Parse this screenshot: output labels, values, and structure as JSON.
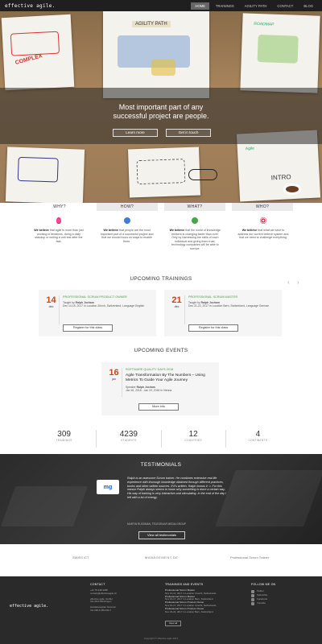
{
  "header": {
    "logo": "effective agile.",
    "nav": [
      "HOME",
      "TRAININGS",
      "AGILITY PATH",
      "CONTACT",
      "BLOG"
    ],
    "active_index": 0
  },
  "hero": {
    "title_line1": "Most important part of any",
    "title_line2": "successful project are people.",
    "btn_learn": "Learn more",
    "btn_touch": "Get in touch",
    "sketch_texts": [
      "AGILITY PATH",
      "COMPLEX",
      "INTRO",
      "ROADMAP",
      "Agile"
    ]
  },
  "tabs": [
    "WHY?",
    "HOW?",
    "WHAT?",
    "WHO?"
  ],
  "why": [
    {
      "bold": "We believe",
      "text": "that agile is more than just working in iterations, doing a daily standup or writing a unit test after the fact."
    },
    {
      "bold": "We believe",
      "text": "that people are the most important part of a successful project and that we should focus on ways to enable them."
    },
    {
      "bold": "We believe",
      "text": "that the world of knowledge workers is changing faster than ever. Only by harnessing the skills of each individual and giving them trust, technology companies will be able to survive."
    },
    {
      "bold": "We believe",
      "text": "that what we have to address our current believe system and that we need to challenge everything."
    }
  ],
  "trainings": {
    "title": "UPCOMING TRAININGS",
    "items": [
      {
        "day": "14",
        "month": "dec",
        "category": "PROFESSIONAL SCRUM PRODUCT OWNER",
        "taught_label": "Taught by",
        "trainer": "Ralph Jocham",
        "meta": "Dec 14-15, 2017 in Location Zürich, Switzerland, Language English",
        "button": "Register for this class"
      },
      {
        "day": "21",
        "month": "dec",
        "category": "PROFESSIONAL SCRUM MASTER",
        "taught_label": "Taught by",
        "trainer": "Ralph Jocham",
        "meta": "Dec 21-22, 2017 in Location Bern, Switzerland, Language German",
        "button": "Register for this class"
      }
    ]
  },
  "events": {
    "title": "UPCOMING EVENTS",
    "item": {
      "day": "16",
      "month": "jan",
      "category": "SOFTWARE QUALITY DAYS 2018",
      "title": "Agile Transformation By The Numbers – Using Metrics To Guide Your Agile Journey",
      "speaker_label": "Speaker",
      "speaker": "Ralph Jocham",
      "meta": "Jan 16, 2018 - Jan 19, 2018 in Vienna",
      "button": "More info"
    }
  },
  "stats": [
    {
      "num": "309",
      "label": "TRAININGS"
    },
    {
      "num": "4239",
      "label": "STUDENTS"
    },
    {
      "num": "12",
      "label": "COUNTRIES"
    },
    {
      "num": "4",
      "label": "CONTINENTS"
    }
  ],
  "testimonials": {
    "title": "TESTIMONIALS",
    "logo": "mg",
    "quote": "Ralph is an awesome Scrum trainer. He combines extensive real life experience with thorough knowledge obtained through different practices, books and other written sources. If it's written, Ralph knows it ☺ For this reason Ralph always seems to know why something is done a certain way. His way of training is very interactive and stimulating. In the end of the day I left with a lot of energy.",
    "author": "MARTIN RUSSMAN, TELEGRAAF MEDIA GROUP",
    "button": "View all testimonials"
  },
  "partners": [
    "SWISS ICT",
    "MANAGEMENT.DE",
    "Professional Scrum Trainer"
  ],
  "footer": {
    "logo": "effective agile.",
    "contact_head": "CONTACT",
    "contact_lines": [
      "+41 79 448 3288",
      "contact@effectiveagile.ch",
      "",
      "effective agile. GmbH",
      "CH-3110 Münsingen",
      "",
      "Handelsregister Nummer",
      "CH-036.4.059.333-7"
    ],
    "training_head": "TRAININGS AND EVENTS",
    "training_lines": [
      {
        "title": "Professional Scrum Master",
        "meta": "Nov 13-14, 2017 in Location Utrecht, Netherlands"
      },
      {
        "title": "Professional Scrum Master",
        "meta": "Nov 16-17, 2017 in Location Bern, Switzerland"
      },
      {
        "title": "Professional Scrum Product Owner",
        "meta": "Nov 16-17, 2017 in Location Utrecht, Netherlands"
      },
      {
        "title": "Professional Scrum Product Owner",
        "meta": "Nov 23-24, 2017 in Location Bern, Switzerland"
      }
    ],
    "view_all": "View all",
    "follow_head": "FOLLOW ME ON",
    "social": [
      "Twitter",
      "Subscribe",
      "Facebook",
      "Youtube"
    ],
    "copyright": "Copyright © effective agile 2017"
  }
}
